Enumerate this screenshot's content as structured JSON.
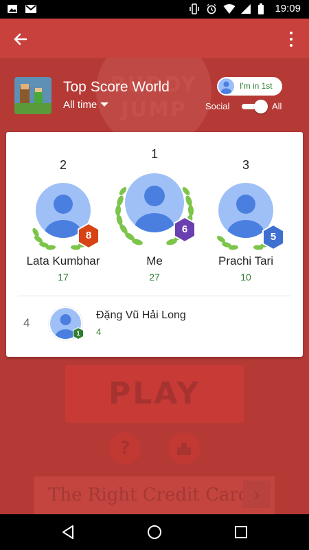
{
  "status_bar": {
    "time": "19:09",
    "icons": [
      "photo-icon",
      "gmail-icon",
      "vibrate-icon",
      "alarm-icon",
      "wifi-icon",
      "signal-icon",
      "battery-icon"
    ]
  },
  "app_bar": {
    "back_icon": "arrow-left-icon",
    "menu_icon": "more-vert-icon"
  },
  "leaderboard": {
    "title": "Top Score World",
    "time_filter": "All time",
    "rank_chip_label": "I'm in 1st",
    "toggle_left_label": "Social",
    "toggle_right_label": "All",
    "toggle_on": true,
    "podium": [
      {
        "rank": "1",
        "name": "Me",
        "score": "27",
        "level": "6",
        "badge_color": "#6a3fb0"
      },
      {
        "rank": "2",
        "name": "Lata Kumbhar",
        "score": "17",
        "level": "8",
        "badge_color": "#d84315"
      },
      {
        "rank": "3",
        "name": "Prachi Tari",
        "score": "10",
        "level": "5",
        "badge_color": "#3f6fd1"
      }
    ],
    "rows": [
      {
        "rank": "4",
        "name": "Đặng Vũ Hải Long",
        "score": "4",
        "level": "1",
        "badge_color": "#2e7d32"
      }
    ]
  },
  "background_game": {
    "logo_line1": "BUDDY",
    "logo_line2": "JUMP",
    "play_label": "PLAY",
    "help_glyph": "?",
    "ad_text": "The Right Credit Card",
    "ad_arrow": "›"
  },
  "colors": {
    "accent_red": "#c8413d",
    "score_green": "#2e7d32",
    "avatar_blue": "#9fc0f7",
    "avatar_person": "#4a7fe0",
    "laurel_green": "#7cc44a"
  }
}
